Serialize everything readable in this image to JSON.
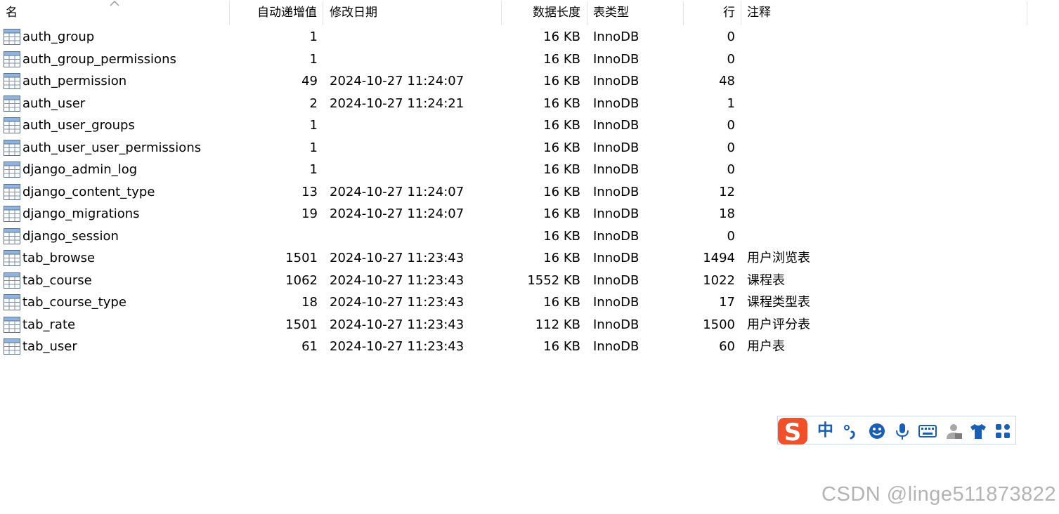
{
  "header": {
    "columns": {
      "name": "名",
      "auto_increment": "自动递增值",
      "modified_date": "修改日期",
      "data_length": "数据长度",
      "table_type": "表类型",
      "rows": "行",
      "comment": "注释"
    },
    "sort_column": "name"
  },
  "tables": [
    {
      "name": "auth_group",
      "auto_increment": "1",
      "modified_date": "",
      "data_length": "16 KB",
      "table_type": "InnoDB",
      "rows": "0",
      "comment": ""
    },
    {
      "name": "auth_group_permissions",
      "auto_increment": "1",
      "modified_date": "",
      "data_length": "16 KB",
      "table_type": "InnoDB",
      "rows": "0",
      "comment": ""
    },
    {
      "name": "auth_permission",
      "auto_increment": "49",
      "modified_date": "2024-10-27 11:24:07",
      "data_length": "16 KB",
      "table_type": "InnoDB",
      "rows": "48",
      "comment": ""
    },
    {
      "name": "auth_user",
      "auto_increment": "2",
      "modified_date": "2024-10-27 11:24:21",
      "data_length": "16 KB",
      "table_type": "InnoDB",
      "rows": "1",
      "comment": ""
    },
    {
      "name": "auth_user_groups",
      "auto_increment": "1",
      "modified_date": "",
      "data_length": "16 KB",
      "table_type": "InnoDB",
      "rows": "0",
      "comment": ""
    },
    {
      "name": "auth_user_user_permissions",
      "auto_increment": "1",
      "modified_date": "",
      "data_length": "16 KB",
      "table_type": "InnoDB",
      "rows": "0",
      "comment": ""
    },
    {
      "name": "django_admin_log",
      "auto_increment": "1",
      "modified_date": "",
      "data_length": "16 KB",
      "table_type": "InnoDB",
      "rows": "0",
      "comment": ""
    },
    {
      "name": "django_content_type",
      "auto_increment": "13",
      "modified_date": "2024-10-27 11:24:07",
      "data_length": "16 KB",
      "table_type": "InnoDB",
      "rows": "12",
      "comment": ""
    },
    {
      "name": "django_migrations",
      "auto_increment": "19",
      "modified_date": "2024-10-27 11:24:07",
      "data_length": "16 KB",
      "table_type": "InnoDB",
      "rows": "18",
      "comment": ""
    },
    {
      "name": "django_session",
      "auto_increment": "",
      "modified_date": "",
      "data_length": "16 KB",
      "table_type": "InnoDB",
      "rows": "0",
      "comment": ""
    },
    {
      "name": "tab_browse",
      "auto_increment": "1501",
      "modified_date": "2024-10-27 11:23:43",
      "data_length": "16 KB",
      "table_type": "InnoDB",
      "rows": "1494",
      "comment": "用户浏览表"
    },
    {
      "name": "tab_course",
      "auto_increment": "1062",
      "modified_date": "2024-10-27 11:23:43",
      "data_length": "1552 KB",
      "table_type": "InnoDB",
      "rows": "1022",
      "comment": "课程表"
    },
    {
      "name": "tab_course_type",
      "auto_increment": "18",
      "modified_date": "2024-10-27 11:23:43",
      "data_length": "16 KB",
      "table_type": "InnoDB",
      "rows": "17",
      "comment": "课程类型表"
    },
    {
      "name": "tab_rate",
      "auto_increment": "1501",
      "modified_date": "2024-10-27 11:23:43",
      "data_length": "112 KB",
      "table_type": "InnoDB",
      "rows": "1500",
      "comment": "用户评分表"
    },
    {
      "name": "tab_user",
      "auto_increment": "61",
      "modified_date": "2024-10-27 11:23:43",
      "data_length": "16 KB",
      "table_type": "InnoDB",
      "rows": "60",
      "comment": "用户表"
    }
  ],
  "ime_toolbar": {
    "mode_label": "中",
    "icons": [
      "sogou-logo-icon",
      "punctuation-icon",
      "emoji-icon",
      "microphone-icon",
      "keyboard-icon",
      "user-icon",
      "skin-shirt-icon",
      "toolbox-grid-icon"
    ],
    "accent_color": "#1a5fb4",
    "logo_color": "#f0502a"
  },
  "watermark": "CSDN @linge511873822"
}
